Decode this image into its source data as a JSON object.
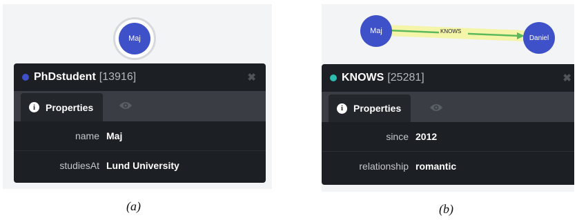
{
  "panel_a": {
    "node": {
      "label": "Maj",
      "color": "#3f51c9"
    },
    "card": {
      "dot_color": "#3f51c9",
      "title": "PhDstudent",
      "id": "[13916]",
      "close_icon": "close-icon",
      "tab_label": "Properties",
      "tab_icon": "info-icon",
      "second_tab_icon": "eye-icon",
      "properties": [
        {
          "key": "name",
          "value": "Maj"
        },
        {
          "key": "studiesAt",
          "value": "Lund University"
        }
      ]
    },
    "caption": "(a)"
  },
  "panel_b": {
    "source_node": {
      "label": "Maj",
      "color": "#3f51c9"
    },
    "target_node": {
      "label": "Daniel",
      "color": "#3f51c9"
    },
    "edge": {
      "label": "KNOWS",
      "color": "#5bb85c",
      "highlight": "#f4f5a8"
    },
    "card": {
      "dot_color": "#2cbdb0",
      "title": "KNOWS",
      "id": "[25281]",
      "close_icon": "close-icon",
      "tab_label": "Properties",
      "tab_icon": "info-icon",
      "second_tab_icon": "eye-icon",
      "properties": [
        {
          "key": "since",
          "value": "2012"
        },
        {
          "key": "relationship",
          "value": "romantic"
        }
      ]
    },
    "caption": "(b)"
  }
}
